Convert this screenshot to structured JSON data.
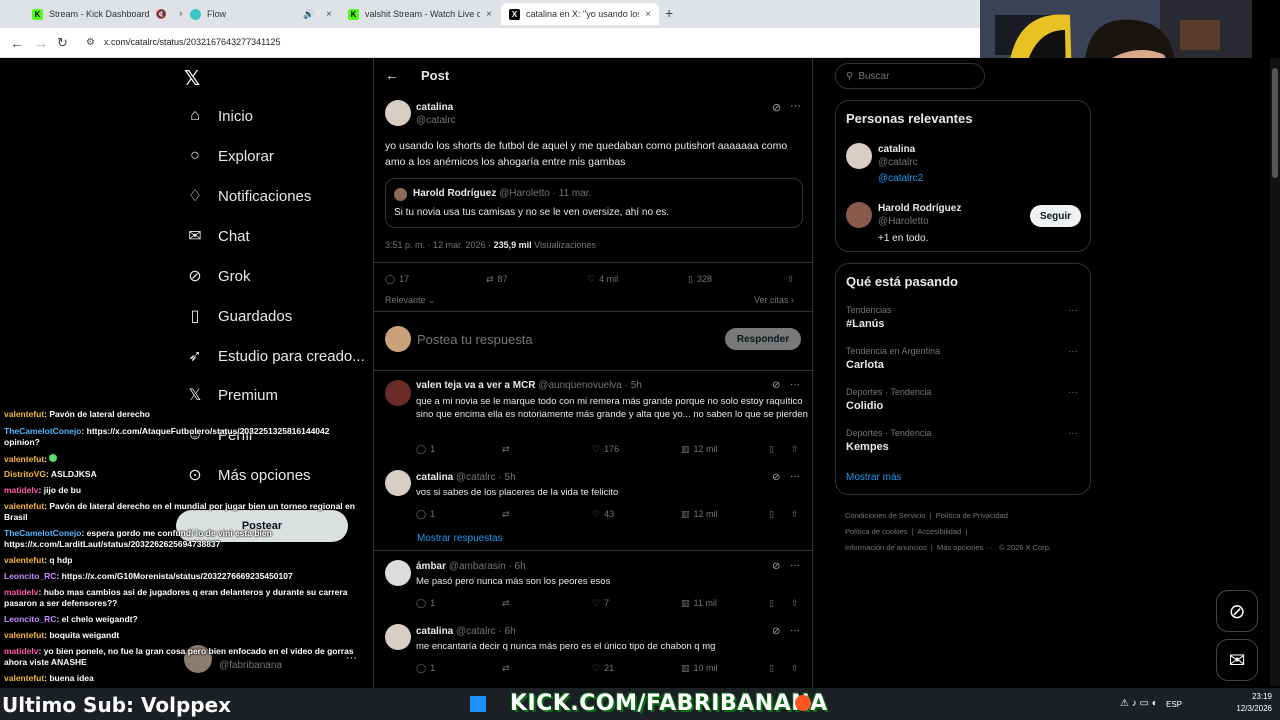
{
  "browser": {
    "tabs": [
      {
        "title": "Stream - Kick Dashboard",
        "fav_color": "#53fc18",
        "fav_text": "K"
      },
      {
        "title": "Flow",
        "fav_color": "#3ec5c5",
        "fav_text": ""
      },
      {
        "title": "valshit Stream - Watch Live on",
        "fav_color": "#53fc18",
        "fav_text": "K"
      },
      {
        "title": "catalina en X: \"yo usando los sh",
        "fav_color": "#000000",
        "fav_text": "X"
      }
    ],
    "new_tab": "+",
    "url": "x.com/catalrc/status/2032167643277341125"
  },
  "nav": {
    "items": [
      {
        "label": "Inicio",
        "icon": "home-icon",
        "glyph": "⌂"
      },
      {
        "label": "Explorar",
        "icon": "search-icon",
        "glyph": "⚲"
      },
      {
        "label": "Notificaciones",
        "icon": "bell-icon",
        "glyph": "🔔"
      },
      {
        "label": "Chat",
        "icon": "mail-icon",
        "glyph": "✉"
      },
      {
        "label": "Grok",
        "icon": "grok-icon",
        "glyph": "⊘"
      },
      {
        "label": "Guardados",
        "icon": "bookmark-icon",
        "glyph": "🔖"
      },
      {
        "label": "Estudio para creado...",
        "icon": "rocket-icon",
        "glyph": "🚀"
      },
      {
        "label": "Premium",
        "icon": "x-logo-icon",
        "glyph": "𝕏"
      },
      {
        "label": "Perfil",
        "icon": "person-icon",
        "glyph": "👤"
      },
      {
        "label": "Más opciones",
        "icon": "more-circle-icon",
        "glyph": "⋯"
      }
    ],
    "post_button": "Postear",
    "account_handle": "@fabribanana",
    "account_more": "···"
  },
  "post": {
    "header_title": "Post",
    "author_name": "catalina",
    "author_handle": "@catalrc",
    "text": "yo usando los shorts de futbol de aquel y me quedaban como putishort aaaaaaa como amo a los anémicos los ahogaría entre mis gambas",
    "quote": {
      "name": "Harold Rodríguez",
      "handle": "@Haroletto",
      "date": "· 11 mar.",
      "text": "Si tu novia usa tus camisas y no se le ven oversize, ahí no es."
    },
    "meta_time": "3:51 p. m. · 12 mar. 2026 ·",
    "meta_views": "235,9 mil",
    "meta_views_label": "Visualizaciones",
    "stats": {
      "replies": "17",
      "reposts": "87",
      "likes": "4 mil",
      "bookmarks": "328"
    },
    "sort_label": "Relevante",
    "quotes_link": "Ver citas ›",
    "reply_placeholder": "Postea tu respuesta",
    "reply_button": "Responder"
  },
  "replies": [
    {
      "name": "valen teja va a ver a MCR",
      "handle": "@aunquenovuelva",
      "time": "· 5h",
      "text": "que a mi novia se le marque todo con mi remera más grande porque no solo estoy raquítico sino que encima ella es notoriamente más grande y alta que yo... no saben lo que se pierden",
      "replies": "1",
      "likes": "176",
      "views": "12 mil"
    },
    {
      "name": "catalina",
      "handle": "@catalrc",
      "time": "· 5h",
      "text": "vos si sabes de los placeres de la vida te felicito",
      "replies": "1",
      "likes": "43",
      "views": "12 mil"
    },
    {
      "name": "ámbar",
      "handle": "@ambarasin",
      "time": "· 6h",
      "text": "Me pasó pero nunca más son los peores esos",
      "replies": "1",
      "likes": "7",
      "views": "11 mil"
    },
    {
      "name": "catalina",
      "handle": "@catalrc",
      "time": "· 6h",
      "text": "me encantaría decir q nunca más pero es el único tipo de chabon q mg",
      "replies": "1",
      "likes": "21",
      "views": "10 mil"
    }
  ],
  "show_replies": "Mostrar respuestas",
  "sidebar": {
    "search_placeholder": "Buscar",
    "relevant_title": "Personas relevantes",
    "people": [
      {
        "name": "catalina",
        "handle": "@catalrc",
        "extra": "@catalrc2"
      },
      {
        "name": "Harold Rodríguez",
        "handle": "@Haroletto",
        "extra": "+1 en todo.",
        "follow": "Seguir"
      }
    ],
    "trends_title": "Qué está pasando",
    "trends": [
      {
        "category": "Tendencias",
        "name": "#Lanús"
      },
      {
        "category": "Tendencia en Argentina",
        "name": "Carlota"
      },
      {
        "category": "Deportes · Tendencia",
        "name": "Colidio"
      },
      {
        "category": "Deportes · Tendencia",
        "name": "Kempes"
      }
    ],
    "show_more": "Mostrar más",
    "footer": [
      "Condiciones de Servicio",
      "Política de Privacidad",
      "Política de cookies",
      "Accesibilidad",
      "Información de anuncios",
      "Más opciones ···",
      "© 2026 X Corp."
    ]
  },
  "chat": [
    {
      "user": "valentefut",
      "msg": "Pavón de lateral derecho",
      "cls": ""
    },
    {
      "user": "TheCamelotConejo",
      "msg": "https://x.com/AtaqueFutbolero/status/2032251325816144042 opinion?",
      "cls": "b"
    },
    {
      "user": "valentefut",
      "msg": "",
      "cls": ""
    },
    {
      "user": "DistritoVG",
      "msg": "ASLDJKSA",
      "cls": ""
    },
    {
      "user": "matidelv",
      "msg": "jijo de bu",
      "cls": "m"
    },
    {
      "user": "valentefut",
      "msg": "Pavón de lateral derecho en el mundial por jugar bien un torneo regional en Brasil",
      "cls": ""
    },
    {
      "user": "TheCamelotConejo",
      "msg": "espera gordo me confundí lo de vini está bien https://x.com/LarditLaut/status/2032262625694738837",
      "cls": "b"
    },
    {
      "user": "valentefut",
      "msg": "q hdp",
      "cls": ""
    },
    {
      "user": "Leoncito_RC",
      "msg": "https://x.com/G10Morenista/status/2032276669235450107",
      "cls": "p"
    },
    {
      "user": "matidelv",
      "msg": "hubo mas cambios asi de jugadores q eran delanteros y durante su carrera pasaron a ser defensores??",
      "cls": "m"
    },
    {
      "user": "Leoncito_RC",
      "msg": "el chelo weigandt?",
      "cls": "p"
    },
    {
      "user": "valentefut",
      "msg": "boquita weigandt",
      "cls": ""
    },
    {
      "user": "matidelv",
      "msg": "yo bien ponele, no fue la gran cosa pero bien enfocado en el video de gorras ahora viste ANASHE",
      "cls": "m"
    },
    {
      "user": "valentefut",
      "msg": "buena idea",
      "cls": ""
    }
  ],
  "stream": {
    "ultimo_sub": "Ultimo Sub: Volppex",
    "kick": "KICK.COM/FABRIBANANA",
    "tray_lang": "ESP",
    "tray_time": "23:19",
    "tray_date": "12/3/2026"
  }
}
